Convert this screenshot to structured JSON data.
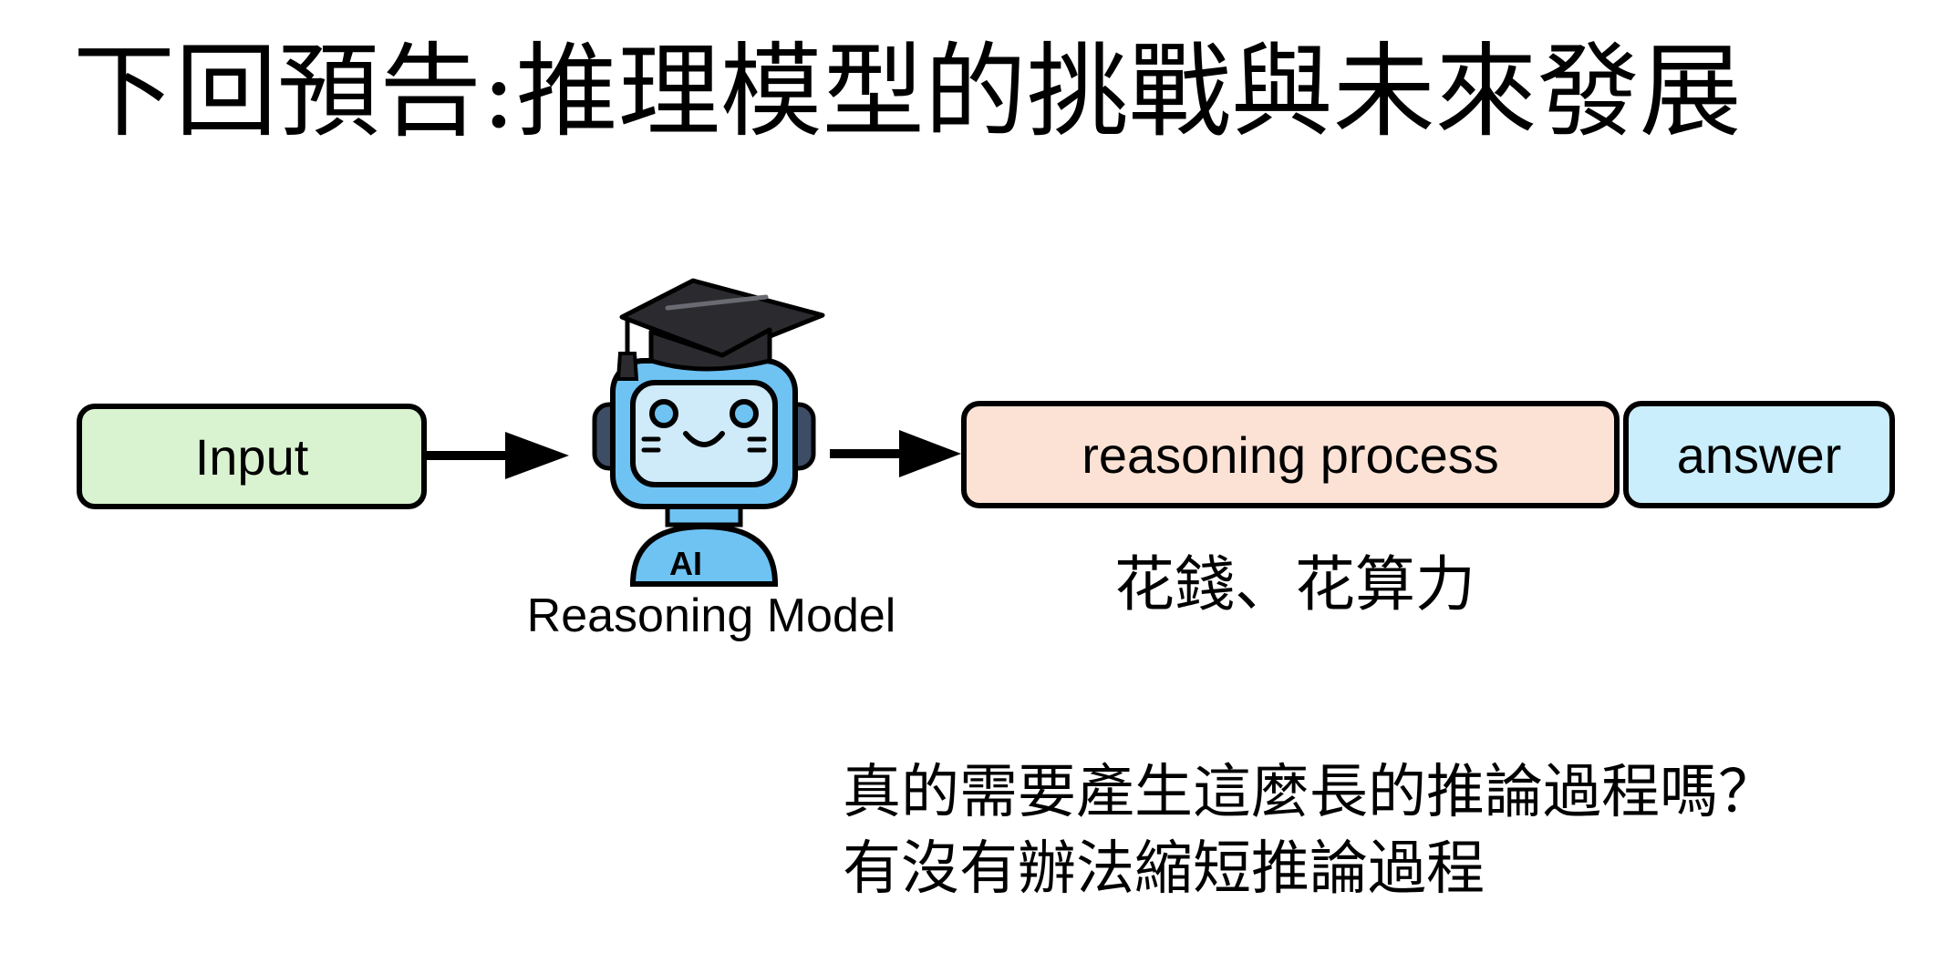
{
  "slide": {
    "title": "下回預告:推理模型的挑戰與未來發展"
  },
  "diagram": {
    "input_label": "Input",
    "model_label": "Reasoning Model",
    "model_badge": "AI",
    "reasoning_label": "reasoning process",
    "answer_label": "answer",
    "cost_note": "花錢、花算力"
  },
  "questions": {
    "line1": "真的需要產生這麼長的推論過程嗎？",
    "line2": "有沒有辦法縮短推論過程"
  },
  "colors": {
    "input_fill": "#d9f2d0",
    "reasoning_fill": "#fbe2d5",
    "answer_fill": "#caeefb",
    "robot_body": "#6fc3f2",
    "robot_screen": "#cfeaf8",
    "robot_ear": "#3d4d66",
    "cap": "#2b2b2f"
  }
}
